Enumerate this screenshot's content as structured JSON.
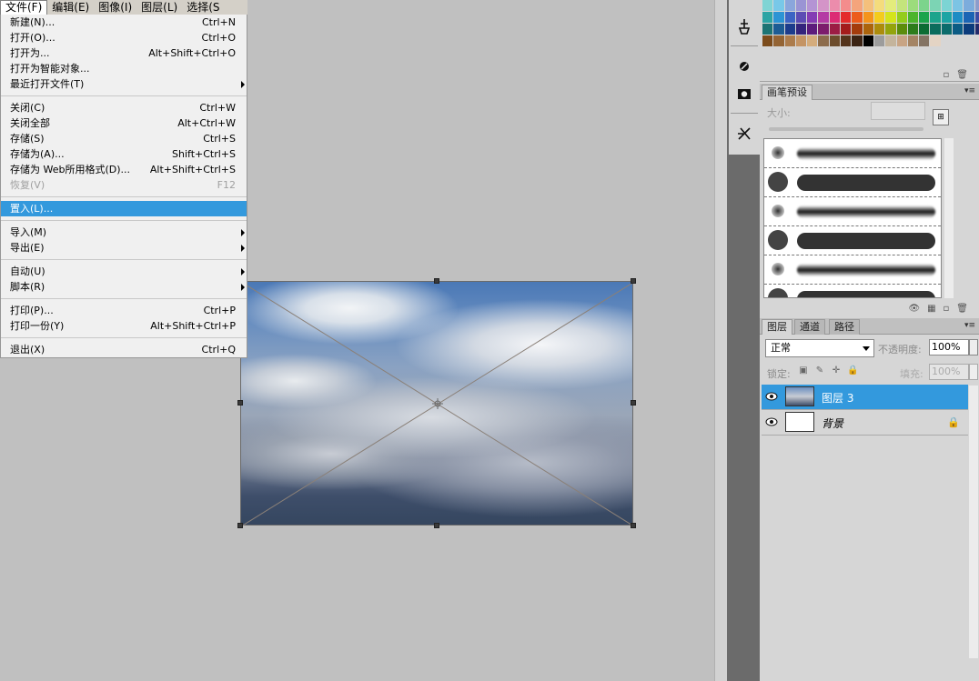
{
  "menubar": {
    "items": [
      "文件(F)",
      "编辑(E)",
      "图像(I)",
      "图层(L)",
      "选择(S"
    ]
  },
  "file_menu": {
    "groups": [
      [
        {
          "label": "新建(N)...",
          "shortcut": "Ctrl+N"
        },
        {
          "label": "打开(O)...",
          "shortcut": "Ctrl+O"
        },
        {
          "label": "打开为...",
          "shortcut": "Alt+Shift+Ctrl+O"
        },
        {
          "label": "打开为智能对象...",
          "shortcut": ""
        },
        {
          "label": "最近打开文件(T)",
          "shortcut": "",
          "submenu": true
        }
      ],
      [
        {
          "label": "关闭(C)",
          "shortcut": "Ctrl+W"
        },
        {
          "label": "关闭全部",
          "shortcut": "Alt+Ctrl+W"
        },
        {
          "label": "存储(S)",
          "shortcut": "Ctrl+S"
        },
        {
          "label": "存储为(A)...",
          "shortcut": "Shift+Ctrl+S"
        },
        {
          "label": "存储为 Web所用格式(D)...",
          "shortcut": "Alt+Shift+Ctrl+S"
        },
        {
          "label": "恢复(V)",
          "shortcut": "F12",
          "disabled": true
        }
      ],
      [
        {
          "label": "置入(L)...",
          "shortcut": "",
          "selected": true
        }
      ],
      [
        {
          "label": "导入(M)",
          "shortcut": "",
          "submenu": true
        },
        {
          "label": "导出(E)",
          "shortcut": "",
          "submenu": true
        }
      ],
      [
        {
          "label": "自动(U)",
          "shortcut": "",
          "submenu": true
        },
        {
          "label": "脚本(R)",
          "shortcut": "",
          "submenu": true
        }
      ],
      [
        {
          "label": "打印(P)...",
          "shortcut": "Ctrl+P"
        },
        {
          "label": "打印一份(Y)",
          "shortcut": "Alt+Shift+Ctrl+P"
        }
      ],
      [
        {
          "label": "退出(X)",
          "shortcut": "Ctrl+Q"
        }
      ]
    ]
  },
  "swatches": {
    "colors": [
      "#7fd4d4",
      "#78c8e8",
      "#8aa6dc",
      "#9a94d4",
      "#b494d4",
      "#d494c8",
      "#ec8cac",
      "#f48c8c",
      "#f4a47c",
      "#f4c07c",
      "#f4dc7c",
      "#e4ec7c",
      "#c4e47c",
      "#9cdc7c",
      "#7cd48c",
      "#7cd4b4",
      "#7cd4d4",
      "#7cc4e4",
      "#7cacdc",
      "#8c9ccc",
      "#2ca4a4",
      "#2c94d4",
      "#3c64c4",
      "#5c4cb4",
      "#843cb4",
      "#b43ca4",
      "#dc2c74",
      "#e42c2c",
      "#ec5c1c",
      "#f4941c",
      "#f4cc1c",
      "#d4e41c",
      "#94cc1c",
      "#4cb42c",
      "#1ca44c",
      "#1ca48c",
      "#1ca4a4",
      "#1c8cc4",
      "#1c64b4",
      "#3c4ca4",
      "#1c7474",
      "#1c5c94",
      "#1c3c8c",
      "#34247c",
      "#5c1c7c",
      "#7c1c6c",
      "#9c1c44",
      "#a41c1c",
      "#a43c0c",
      "#ac640c",
      "#ac8c0c",
      "#94a40c",
      "#5c8c0c",
      "#2c7c1c",
      "#0c6c34",
      "#0c6c5c",
      "#0c6c6c",
      "#0c5c84",
      "#0c3c7c",
      "#242c6c",
      "#7c4c1c",
      "#946434",
      "#ac7c4c",
      "#c49464",
      "#d4ac7c",
      "#8c6c4c",
      "#6c4c2c",
      "#54341c",
      "#3c2414",
      "#000000",
      "#9c9c9c",
      "#c4b49c",
      "#c8a484",
      "#a48464",
      "#847464",
      "#e4d4c4"
    ]
  },
  "brush_panel": {
    "tab": "画笔预设",
    "size_label": "大小:",
    "rows": [
      "soft",
      "hard",
      "soft",
      "hard",
      "soft",
      "hard"
    ]
  },
  "layers_panel": {
    "tabs": [
      "图层",
      "通道",
      "路径"
    ],
    "blend_mode": "正常",
    "opacity_label": "不透明度:",
    "opacity_value": "100%",
    "lock_label": "锁定:",
    "fill_label": "填充:",
    "fill_value": "100%",
    "layers": [
      {
        "name": "图层 3",
        "selected": true,
        "italic": false,
        "locked": false
      },
      {
        "name": "背景",
        "selected": false,
        "italic": true,
        "locked": true
      }
    ]
  },
  "icons": {
    "tools": [
      "usb-stamp-icon",
      "dodge-icon",
      "camera-icon",
      "pen-tools-icon"
    ]
  },
  "colors": {
    "menu_highlight": "#3399dd",
    "layer_highlight": "#3399dd",
    "workspace": "#c0c0c0",
    "toolbar_dark": "#6b6b6b"
  }
}
